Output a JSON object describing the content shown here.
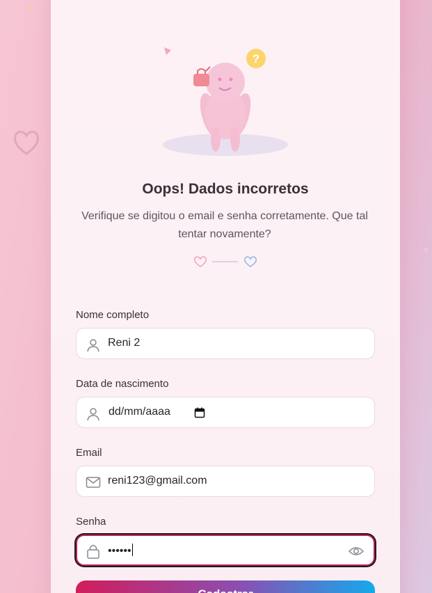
{
  "error": {
    "title": "Oops! Dados incorretos",
    "message": "Verifique se digitou o email e senha corretamente. Que tal tentar novamente?"
  },
  "form": {
    "name": {
      "label": "Nome completo",
      "value": "Reni 2",
      "icon": "user-icon"
    },
    "birthdate": {
      "label": "Data de nascimento",
      "value": "dd/mm/aaaa",
      "icon": "user-icon"
    },
    "email": {
      "label": "Email",
      "value": "reni123@gmail.com",
      "icon": "mail-icon"
    },
    "password": {
      "label": "Senha",
      "value": "••••••",
      "icon": "lock-icon"
    },
    "submit_label": "Cadastrar"
  },
  "colors": {
    "accent_pink": "#d11d5b",
    "accent_blue": "#15a9ec"
  }
}
